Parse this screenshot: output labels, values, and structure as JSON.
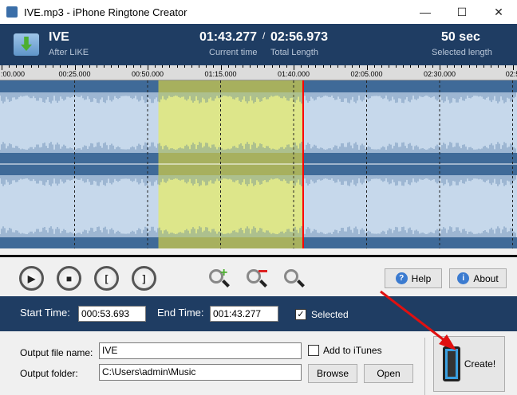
{
  "window": {
    "title": "IVE.mp3 - iPhone Ringtone Creator",
    "minimize": "—",
    "maximize": "☐",
    "close": "✕"
  },
  "header": {
    "track_title": "IVE",
    "artist": "After LIKE",
    "current_time": "01:43.277",
    "separator": "/",
    "total_length": "02:56.973",
    "current_time_label": "Current time",
    "total_length_label": "Total Length",
    "selected_length": "50 sec",
    "selected_length_label": "Selected length"
  },
  "ruler": {
    "labels": [
      ":00.000",
      "00:25.000",
      "00:50.000",
      "01:15.000",
      "01:40.000",
      "02:05.000",
      "02:30.000",
      "02:5"
    ]
  },
  "waveform": {
    "selection_start_sec": 53.693,
    "selection_end_sec": 103.277,
    "total_sec": 176.973,
    "colors": {
      "background": "#c6d8eb",
      "selection": "#dde68a",
      "strip": "#3f6a98",
      "cursor": "#ff0000"
    }
  },
  "toolbar": {
    "play": "▶",
    "stop": "■",
    "mark_start": "[",
    "mark_end": "]",
    "help_label": "Help",
    "about_label": "About"
  },
  "times": {
    "start_label": "Start Time:",
    "start_value": "000:53.693",
    "end_label": "End Time:",
    "end_value": "001:43.277",
    "selected_label": "Selected",
    "selected_checked": true
  },
  "output": {
    "file_name_label": "Output file name:",
    "file_name_value": "IVE",
    "add_itunes_label": "Add to iTunes",
    "folder_label": "Output folder:",
    "folder_value": "C:\\Users\\admin\\Music",
    "browse_label": "Browse",
    "open_label": "Open",
    "create_label": "Create!"
  }
}
